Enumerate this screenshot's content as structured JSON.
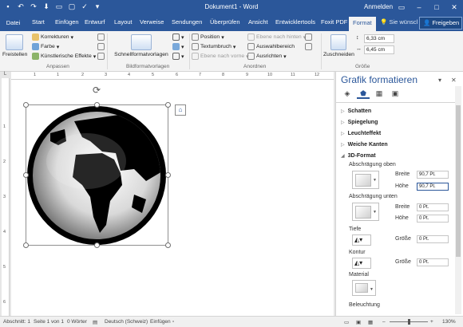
{
  "titlebar": {
    "title": "Dokument1 - Word",
    "signin": "Anmelden"
  },
  "tabs": {
    "file": "Datei",
    "items": [
      "Start",
      "Einfügen",
      "Entwurf",
      "Layout",
      "Verweise",
      "Sendungen",
      "Überprüfen",
      "Ansicht",
      "Entwicklertools",
      "Foxit PDF"
    ],
    "active": "Format",
    "tellme": "Sie wünscl",
    "share": "Freigeben"
  },
  "ribbon": {
    "freistellen": "Freistellen",
    "korrekturen": "Korrekturen",
    "farbe": "Farbe",
    "kuenstlerisch": "Künstlerische Effekte",
    "anpassen_label": "Anpassen",
    "schnellformat": "Schnellformatvorlagen",
    "bildformat_label": "Bildformatvorlagen",
    "position": "Position",
    "textumbruch": "Textumbruch",
    "ebene_vorne": "Ebene nach vorne",
    "ebene_hinten": "Ebene nach hinten",
    "auswahlbereich": "Auswahlbereich",
    "ausrichten": "Ausrichten",
    "anordnen_label": "Anordnen",
    "zuschneiden": "Zuschneiden",
    "height_value": "6,33 cm",
    "width_value": "6,45 cm",
    "groesse_label": "Größe"
  },
  "ruler": {
    "corner": "L",
    "h_numbers": [
      "1",
      "1",
      "2",
      "3",
      "4",
      "5",
      "6",
      "7",
      "8",
      "9",
      "10",
      "11",
      "12"
    ],
    "v_numbers": [
      "1",
      "2",
      "3",
      "4",
      "5",
      "6"
    ]
  },
  "pane": {
    "title": "Grafik formatieren",
    "sections": {
      "schatten": "Schatten",
      "spiegelung": "Spiegelung",
      "leuchteffekt": "Leuchteffekt",
      "weiche_kanten": "Weiche Kanten",
      "format3d": "3D-Format"
    },
    "abschraegung_oben": "Abschrägung oben",
    "abschraegung_unten": "Abschrägung unten",
    "breite": "Breite",
    "hoehe": "Höhe",
    "oben_breite": "90,7 Pt.",
    "oben_hoehe": "90,7 Pt.",
    "unten_breite": "0 Pt.",
    "unten_hoehe": "0 Pt.",
    "tiefe": "Tiefe",
    "kontur": "Kontur",
    "groesse": "Größe",
    "tiefe_groesse": "0 Pt.",
    "kontur_groesse": "0 Pt.",
    "material": "Material",
    "beleuchtung": "Beleuchtung"
  },
  "status": {
    "abschnitt": "Abschnitt: 1",
    "seite": "Seite 1 von 1",
    "woerter": "0 Wörter",
    "sprache": "Deutsch (Schweiz)",
    "modus": "Einfügen",
    "zoom": "130%"
  },
  "colors": {
    "brand": "#2b579a"
  }
}
